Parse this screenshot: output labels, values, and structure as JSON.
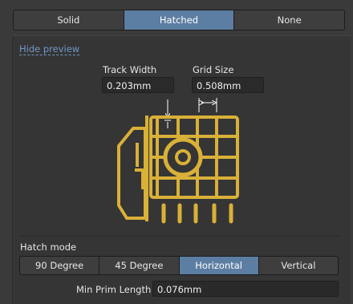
{
  "fill_modes": {
    "items": [
      "Solid",
      "Hatched",
      "None"
    ],
    "selected": "Hatched"
  },
  "preview": {
    "toggle_label": "Hide preview",
    "track_width_label": "Track Width",
    "track_width_value": "0.203mm",
    "grid_size_label": "Grid Size",
    "grid_size_value": "0.508mm"
  },
  "hatch_mode": {
    "label": "Hatch mode",
    "items": [
      "90 Degree",
      "45 Degree",
      "Horizontal",
      "Vertical"
    ],
    "selected": "Horizontal"
  },
  "min_prim": {
    "label": "Min Prim Length",
    "value": "0.076mm"
  },
  "colors": {
    "accent": "#5d7ea3",
    "preview_copper": "#d9b038",
    "link": "#6f98c8"
  }
}
